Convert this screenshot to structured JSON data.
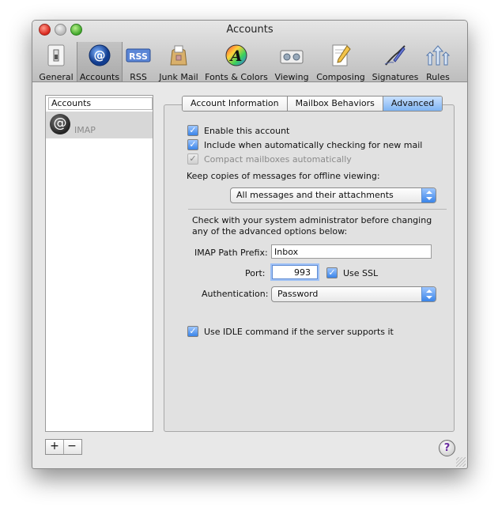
{
  "window": {
    "title": "Accounts"
  },
  "toolbar": {
    "items": [
      {
        "label": "General",
        "icon": "light-switch-icon"
      },
      {
        "label": "Accounts",
        "icon": "at-sign-icon"
      },
      {
        "label": "RSS",
        "icon": "rss-icon"
      },
      {
        "label": "Junk Mail",
        "icon": "junk-mail-bag-icon"
      },
      {
        "label": "Fonts & Colors",
        "icon": "fonts-colors-icon"
      },
      {
        "label": "Viewing",
        "icon": "viewing-icon"
      },
      {
        "label": "Composing",
        "icon": "pencil-paper-icon"
      },
      {
        "label": "Signatures",
        "icon": "pen-icon"
      },
      {
        "label": "Rules",
        "icon": "rules-arrows-icon"
      }
    ],
    "accounts_glyph": "@",
    "rss_glyph": "RSS",
    "fonts_glyph": "A"
  },
  "sidebar": {
    "header": "Accounts",
    "accounts": [
      {
        "name": "IMAP",
        "glyph": "@"
      }
    ],
    "add_label": "+",
    "remove_label": "−"
  },
  "tabs": [
    {
      "label": "Account Information",
      "active": false
    },
    {
      "label": "Mailbox Behaviors",
      "active": false
    },
    {
      "label": "Advanced",
      "active": true
    }
  ],
  "advanced": {
    "enable_account": {
      "label": "Enable this account",
      "checked": true
    },
    "include_check": {
      "label": "Include when automatically checking for new mail",
      "checked": true
    },
    "compact": {
      "label": "Compact mailboxes automatically",
      "checked": true,
      "disabled": true
    },
    "offline_label": "Keep copies of messages for offline viewing:",
    "offline_value": "All messages and their attachments",
    "admin_note_line1": "Check with your system administrator before changing",
    "admin_note_line2": "any of the advanced options below:",
    "imap_prefix_label": "IMAP Path Prefix:",
    "imap_prefix_value": "Inbox",
    "port_label": "Port:",
    "port_value": "993",
    "use_ssl": {
      "label": "Use SSL",
      "checked": true
    },
    "auth_label": "Authentication:",
    "auth_value": "Password",
    "idle": {
      "label": "Use IDLE command if the server supports it",
      "checked": true
    }
  },
  "help_glyph": "?",
  "checkmark_glyph": "✓"
}
